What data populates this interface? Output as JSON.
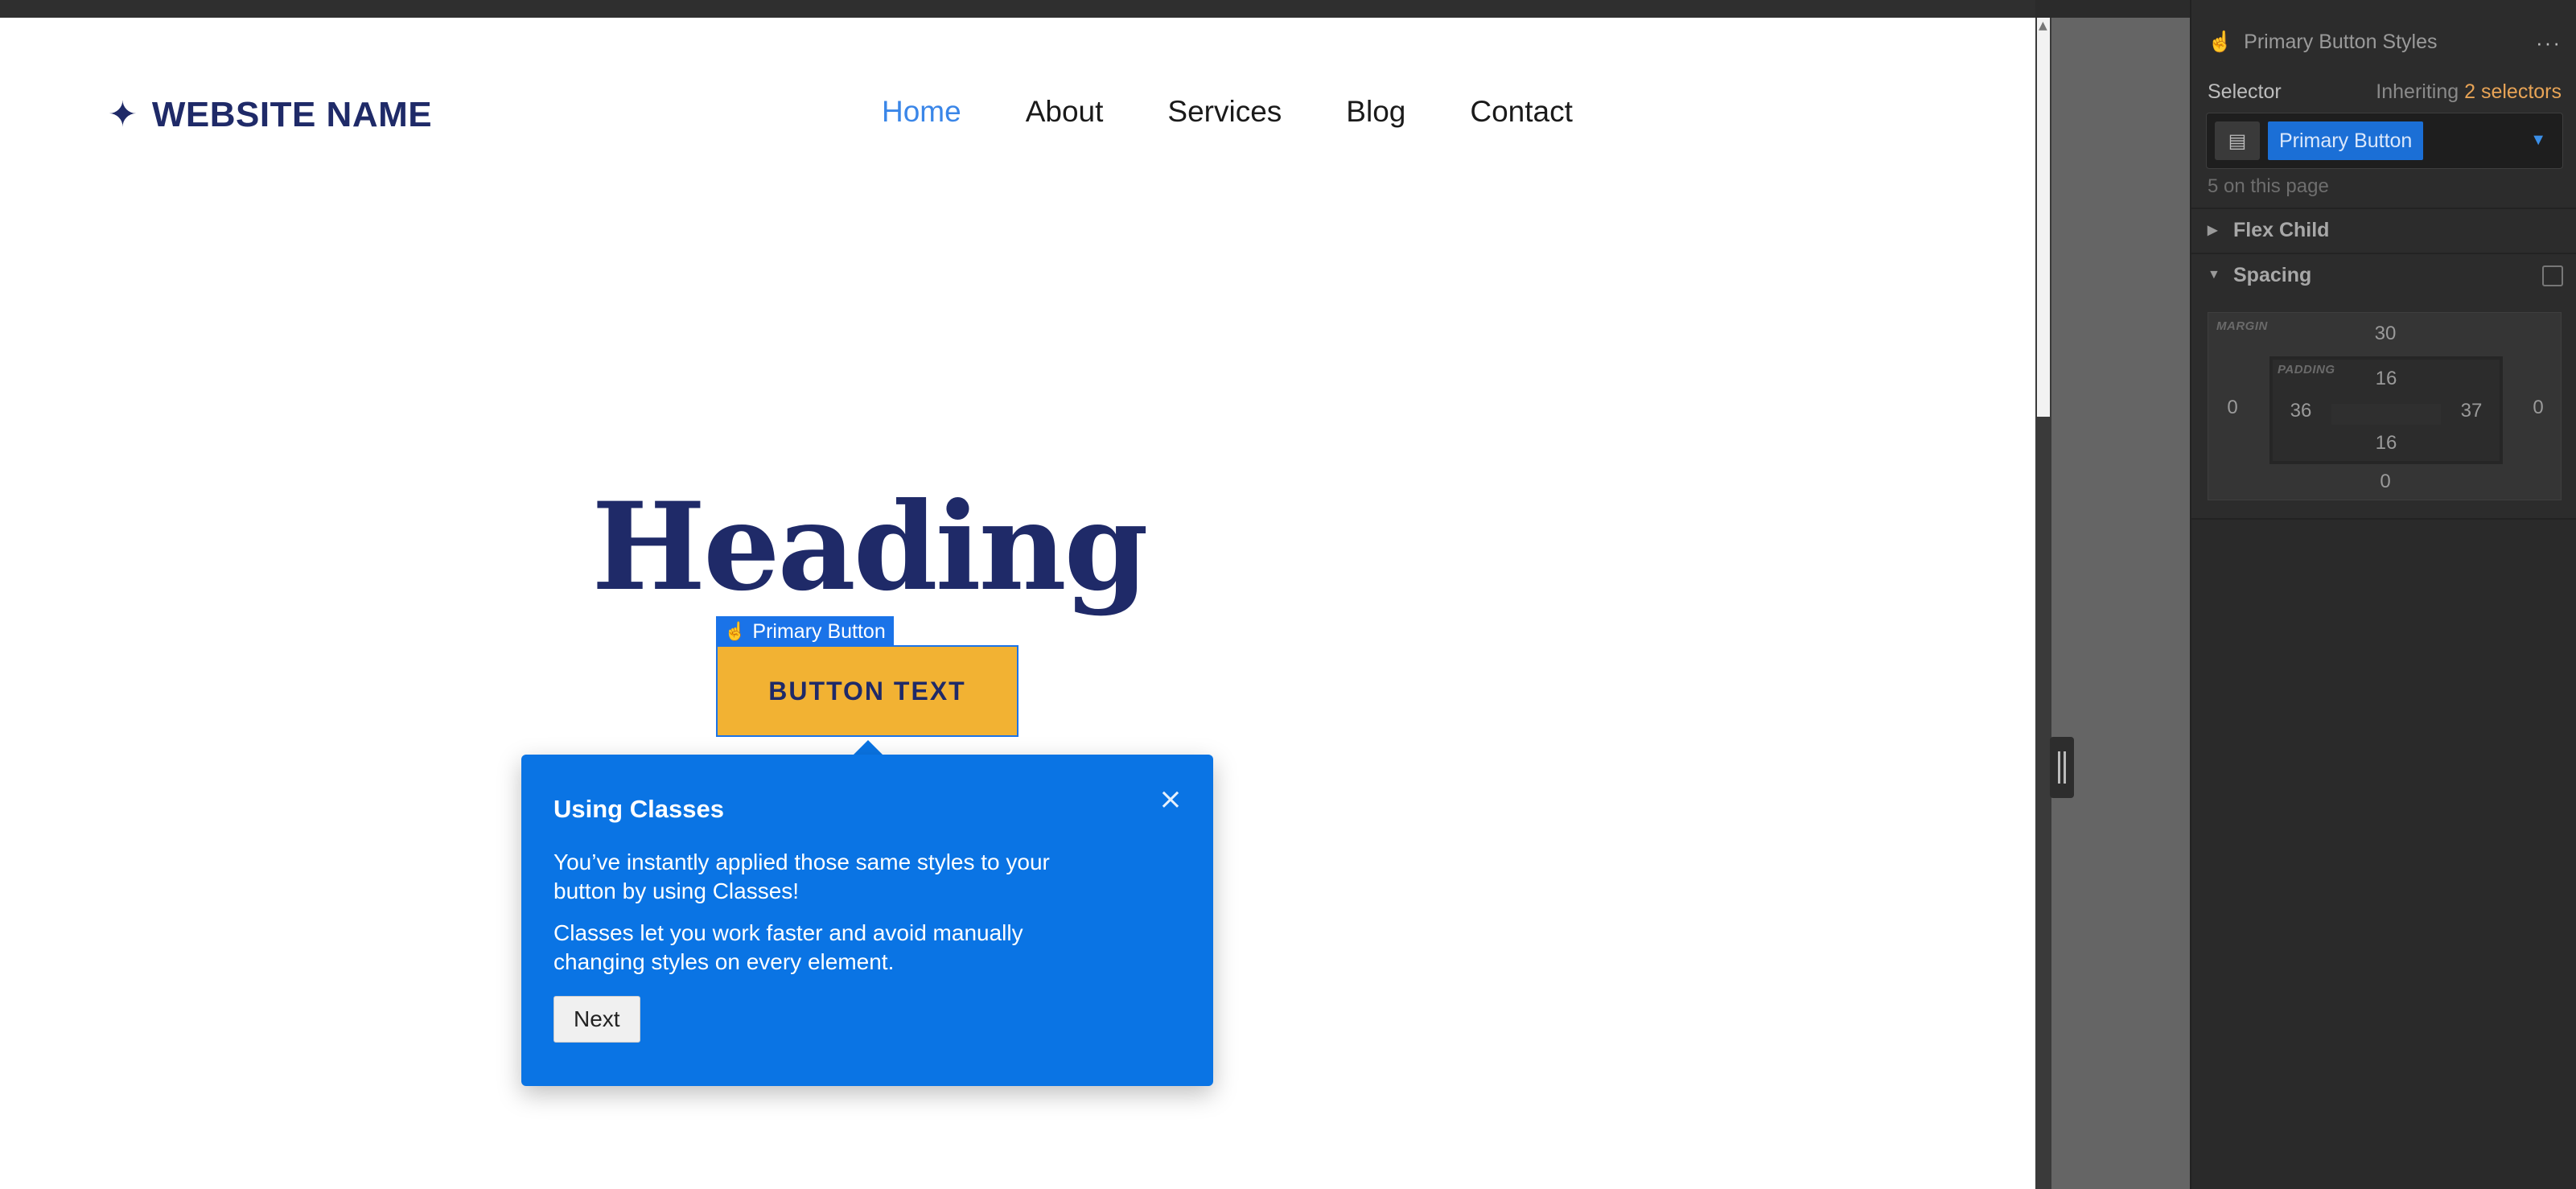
{
  "site": {
    "brand_icon": "✦",
    "brand_name": "WEBSITE NAME",
    "nav": [
      {
        "label": "Home",
        "active": true
      },
      {
        "label": "About",
        "active": false
      },
      {
        "label": "Services",
        "active": false
      },
      {
        "label": "Blog",
        "active": false
      },
      {
        "label": "Contact",
        "active": false
      }
    ],
    "heading": "Heading",
    "selection_tag": "Primary Button",
    "button_text": "BUTTON TEXT"
  },
  "tour": {
    "title": "Using Classes",
    "paragraph1": "You’ve instantly applied those same styles to your button by using Classes!",
    "paragraph2": "Classes let you work faster and avoid manually changing styles on every element.",
    "next_label": "Next",
    "close_glyph": "×"
  },
  "panel": {
    "title": "Primary Button Styles",
    "more_glyph": "···",
    "selector_label": "Selector",
    "inheriting_prefix": "Inheriting",
    "inheriting_link": "2 selectors",
    "selector_chip": "Primary Button",
    "on_page": "5 on this page",
    "sections": [
      {
        "label": "Flex Child",
        "expanded": false
      },
      {
        "label": "Spacing",
        "expanded": true
      }
    ],
    "spacing": {
      "margin_label": "MARGIN",
      "padding_label": "PADDING",
      "margin": {
        "top": "30",
        "right": "0",
        "bottom": "0",
        "left": "0"
      },
      "padding": {
        "top": "16",
        "right": "37",
        "bottom": "16",
        "left": "36"
      }
    }
  },
  "colors": {
    "brand_navy": "#1f2a68",
    "nav_active": "#3a86e8",
    "button_fill": "#f2b233",
    "tooltip_blue": "#0a74e4",
    "selection_blue": "#1a73e8",
    "inherit_orange": "#e8a456"
  }
}
